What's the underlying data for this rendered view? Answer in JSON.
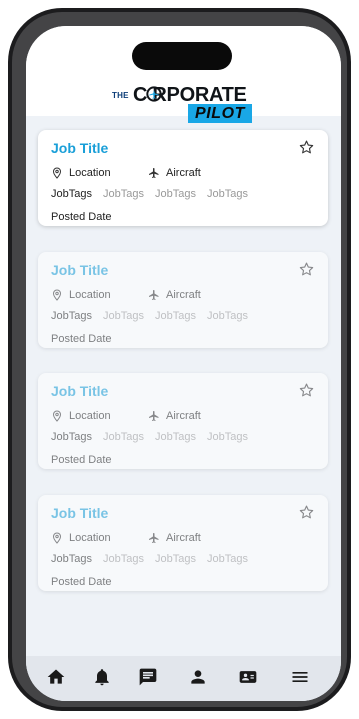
{
  "brand": {
    "prefix": "THE",
    "name_main": "C RPORATE",
    "name_sub": "PILOT",
    "accent_color": "#19a7e6"
  },
  "jobs": [
    {
      "title": "Job Title",
      "location": "Location",
      "aircraft": "Aircraft",
      "tags": [
        "JobTags",
        "JobTags",
        "JobTags",
        "JobTags"
      ],
      "posted": "Posted Date",
      "faded": false
    },
    {
      "title": "Job Title",
      "location": "Location",
      "aircraft": "Aircraft",
      "tags": [
        "JobTags",
        "JobTags",
        "JobTags",
        "JobTags"
      ],
      "posted": "Posted Date",
      "faded": true
    },
    {
      "title": "Job Title",
      "location": "Location",
      "aircraft": "Aircraft",
      "tags": [
        "JobTags",
        "JobTags",
        "JobTags",
        "JobTags"
      ],
      "posted": "Posted Date",
      "faded": true
    },
    {
      "title": "Job Title",
      "location": "Location",
      "aircraft": "Aircraft",
      "tags": [
        "JobTags",
        "JobTags",
        "JobTags",
        "JobTags"
      ],
      "posted": "Posted Date",
      "faded": true
    }
  ],
  "nav": [
    {
      "icon": "home-icon"
    },
    {
      "icon": "bell-icon"
    },
    {
      "icon": "chat-icon"
    },
    {
      "icon": "person-icon"
    },
    {
      "icon": "id-card-icon"
    },
    {
      "icon": "menu-icon"
    }
  ]
}
